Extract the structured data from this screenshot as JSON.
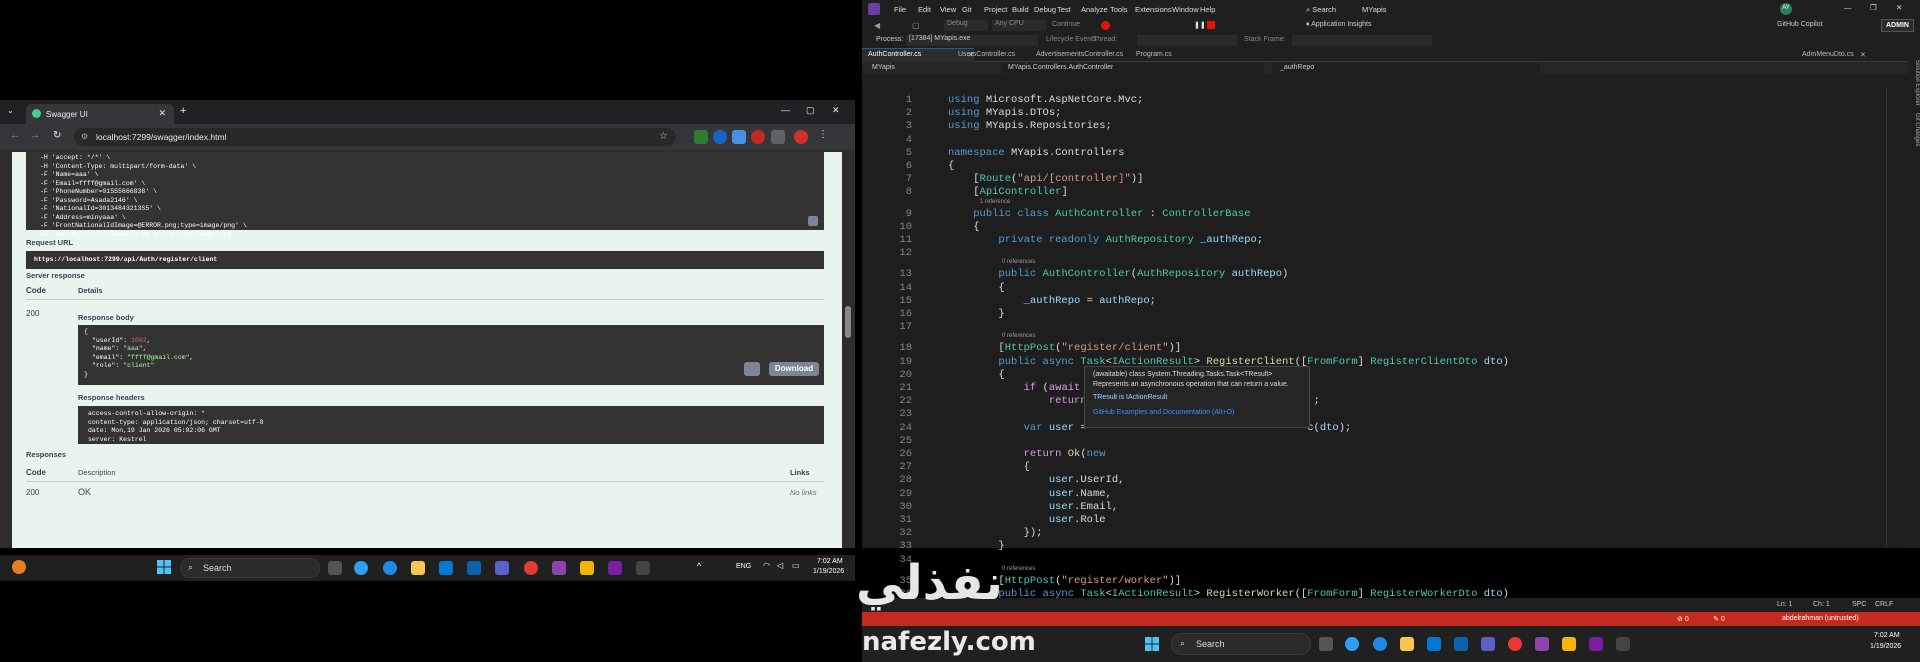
{
  "browser": {
    "tab_title": "Swagger UI",
    "url": "localhost:7299/swagger/index.html",
    "curl_lines": [
      "-H 'accept: */*' \\",
      "-H 'Content-Type: multipart/form-data' \\",
      "-F 'Name=aaa' \\",
      "-F 'Email=ffff@gmail.com' \\",
      "-F 'PhoneNumber=01555666838' \\",
      "-F 'Password=Asada2146' \\",
      "-F 'NationalId=30134843213S5' \\",
      "-F 'Address=minyaaa' \\",
      "-F 'FrontNationalIdImage=@ERROR.png;type=image/png' \\",
      "-F 'BackNationalIdImage=@lap 4.png;type=image/png'"
    ],
    "request_url_label": "Request URL",
    "request_url": "https://localhost:7299/api/Auth/register/client",
    "server_response_label": "Server response",
    "code_header": "Code",
    "details_header": "Details",
    "status_code": "200",
    "response_body_label": "Response body",
    "response_body": {
      "open": "{",
      "lines": [
        {
          "key": "\"userId\": ",
          "val": "1002",
          "comma": ","
        },
        {
          "key": "\"name\": ",
          "val": "\"aaa\"",
          "comma": ","
        },
        {
          "key": "\"email\": ",
          "val": "\"ffff@gmail.com\"",
          "comma": ","
        },
        {
          "key": "\"role\": ",
          "val": "\"client\"",
          "comma": ""
        }
      ],
      "close": "}"
    },
    "download_label": "Download",
    "response_headers_label": "Response headers",
    "response_headers": [
      "access-control-allow-origin: *",
      "content-type: application/json; charset=utf-8",
      "date: Mon,19 Jan 2026 05:02:06 GMT",
      "server: Kestrel"
    ],
    "responses_label": "Responses",
    "resp_code_header": "Code",
    "resp_desc_header": "Description",
    "resp_links_header": "Links",
    "resp_code": "200",
    "resp_desc": "OK",
    "resp_links": "No links"
  },
  "taskbar_left": {
    "search": "Search",
    "lang": "ENG",
    "time": "7:02 AM",
    "date": "1/19/2026"
  },
  "taskbar_right": {
    "search": "Search",
    "time": "7:02 AM",
    "date": "1/19/2026"
  },
  "vs": {
    "menu": [
      "File",
      "Edit",
      "View",
      "Git",
      "Project",
      "Build",
      "Debug",
      "Test",
      "Analyze",
      "Tools",
      "Extensions",
      "Window",
      "Help"
    ],
    "search": "Search",
    "solution": "MYapis",
    "user_initials": "AY",
    "copilot": "GitHub Copilot",
    "admin": "ADMIN",
    "app_insights": "Application Insights",
    "debug_config": "Debug",
    "cpu": "Any CPU",
    "continue": "Continue",
    "process_label": "Process:",
    "process": "[17384] MYapis.exe",
    "lifecycle": "Lifecycle Events",
    "thread": "Thread:",
    "stack": "Stack Frame:",
    "tabs": [
      "AuthController.cs",
      "UsersController.cs",
      "AdvertisementsController.cs",
      "Program.cs"
    ],
    "right_tab": "AdmMenuDto.cs",
    "nav_project": "MYapis",
    "nav_class": "MYapis.Controllers.AuthController",
    "nav_member": "_authRepo",
    "side_labels": [
      "Solution Explorer",
      "Git Changes"
    ],
    "tooltip": {
      "title": "(awaitable) class System.Threading.Tasks.Task<TResult>",
      "desc": "Represents an asynchronous operation that can return a value.",
      "tresult": "TResult is IActionResult",
      "link": "GitHub Examples and Documentation (Alt+O)"
    },
    "status": {
      "ln": "Ln: 1",
      "ch": "Ch: 1",
      "spc": "SPC",
      "crlf": "CRLF"
    },
    "redbar": {
      "errors": "0",
      "warnings": "0",
      "user": "abdelrahman (untrusted)"
    },
    "refs": {
      "one": "1 reference",
      "zero": "0 references"
    }
  },
  "watermark": {
    "arabic": "نفذلي",
    "latin": "nafezly.com"
  }
}
